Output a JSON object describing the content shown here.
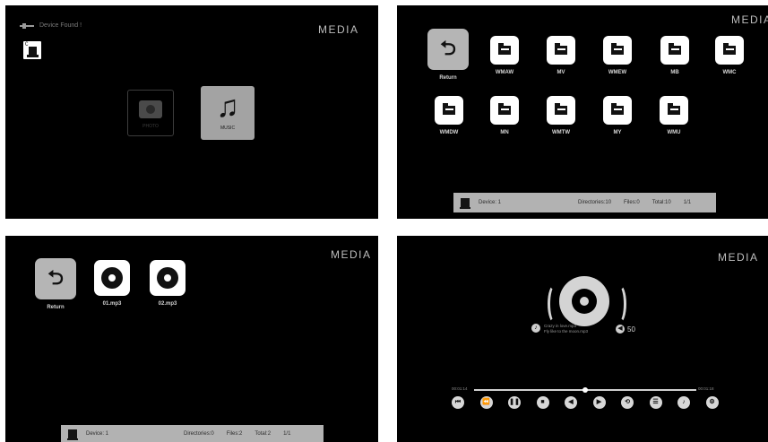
{
  "colors": {
    "panel_bg": "#000000",
    "tile_bg": "#ffffff",
    "return_bg": "#b5b5b5",
    "statusbar_bg": "#b2b2b2"
  },
  "panel1": {
    "device_found": "Device Found !",
    "drive_letter": "C",
    "media": "MEDIA",
    "photo_label": "PHOTO",
    "music_label": "MUSIC",
    "music_icon": "music-note-icon"
  },
  "panel2": {
    "media": "MEDIA",
    "items": [
      {
        "label": "Return",
        "icon": "return-icon"
      },
      {
        "label": "WMAW",
        "icon": "folder-icon"
      },
      {
        "label": "MV",
        "icon": "folder-icon"
      },
      {
        "label": "WMEW",
        "icon": "folder-icon"
      },
      {
        "label": "MB",
        "icon": "folder-icon"
      },
      {
        "label": "WMC",
        "icon": "folder-icon"
      },
      {
        "label": "WMDW",
        "icon": "folder-icon"
      },
      {
        "label": "MN",
        "icon": "folder-icon"
      },
      {
        "label": "WMTW",
        "icon": "folder-icon"
      },
      {
        "label": "MY",
        "icon": "folder-icon"
      },
      {
        "label": "WMU",
        "icon": "folder-icon"
      }
    ],
    "status": {
      "device": "Device: 1",
      "directories": "Directories:10",
      "files": "Files:0",
      "total": "Total:10",
      "page": "1/1"
    }
  },
  "panel3": {
    "media": "MEDIA",
    "items": [
      {
        "label": "Return",
        "icon": "return-icon"
      },
      {
        "label": "01.mp3",
        "icon": "disc-icon"
      },
      {
        "label": "02.mp3",
        "icon": "disc-icon"
      }
    ],
    "status": {
      "device": "Device: 1",
      "directories": "Directories:0",
      "files": "Files:2",
      "total": "Total:2",
      "page": "1/1"
    }
  },
  "panel4": {
    "media": "MEDIA",
    "song_line1": "Crazy in love.mp3",
    "song_line2": "Fly like to the moon.mp3",
    "volume": "50",
    "time_elapsed": "00:01:14",
    "time_total": "00:01:18",
    "progress_fraction": 0.5,
    "controls": [
      "prev-track",
      "rewind",
      "pause",
      "stop",
      "previous",
      "next",
      "repeat",
      "playlist",
      "volume",
      "settings"
    ]
  }
}
